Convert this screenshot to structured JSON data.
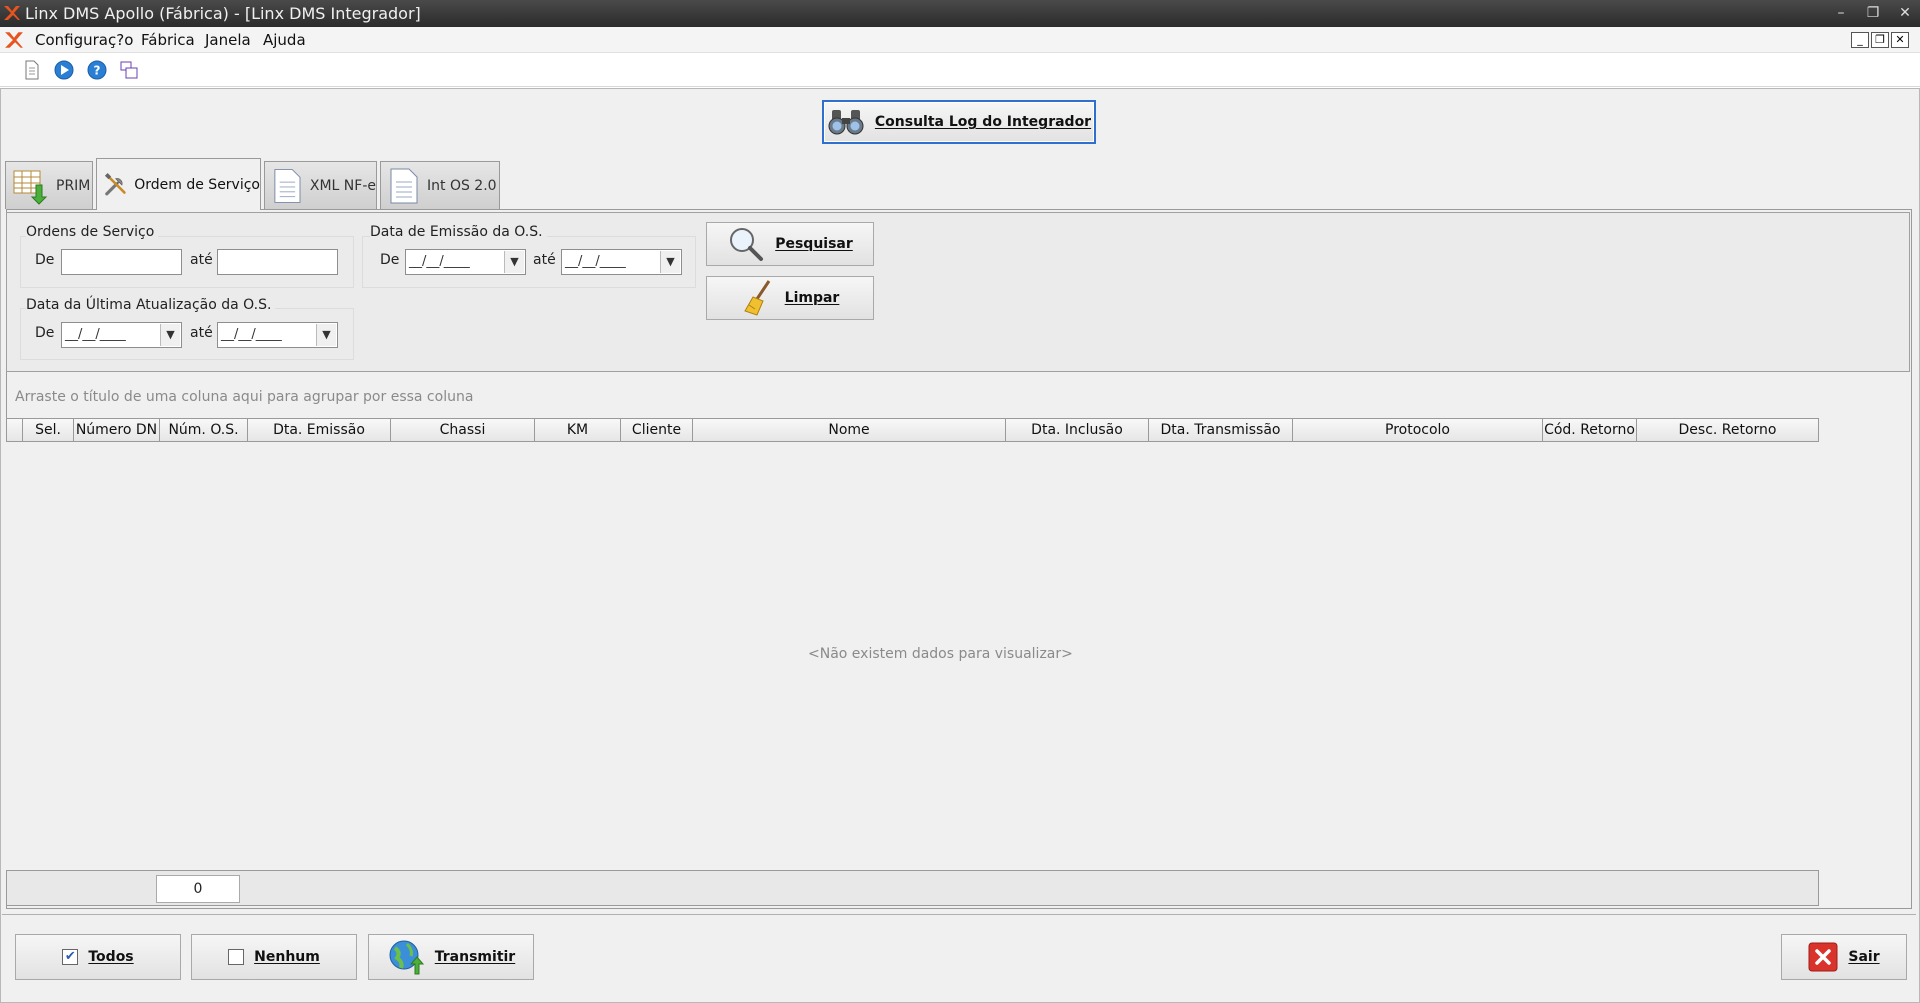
{
  "window": {
    "title": "Linx DMS Apollo (Fábrica) - [Linx DMS Integrador]"
  },
  "menu": [
    "Configuraç?o",
    "Fábrica",
    "Janela",
    "Ajuda"
  ],
  "log_button": "Consulta Log do Integrador",
  "tabs": [
    {
      "label": "PRIM",
      "icon": "table-arrow-icon"
    },
    {
      "label": "Ordem de Serviço",
      "icon": "tools-icon"
    },
    {
      "label": "XML NF-e",
      "icon": "document-icon"
    },
    {
      "label": "Int OS 2.0",
      "icon": "document-icon"
    }
  ],
  "filters": {
    "os_group": "Ordens de Serviço",
    "emissao_group": "Data de Emissão da O.S.",
    "atualizacao_group": "Data da Última Atualização da O.S.",
    "de": "De",
    "ate": "até",
    "date_placeholder": "__/__/____",
    "os_de_value": "",
    "os_ate_value": ""
  },
  "search_button": "Pesquisar",
  "clear_button": "Limpar",
  "grid": {
    "group_hint": "Arraste o título de uma coluna aqui para agrupar por essa coluna",
    "columns": [
      "",
      "Sel.",
      "Número DN",
      "Núm. O.S.",
      "Dta. Emissão",
      "Chassi",
      "KM",
      "Cliente",
      "Nome",
      "Dta. Inclusão",
      "Dta. Transmissão",
      "Protocolo",
      "Cód. Retorno",
      "Desc. Retorno"
    ],
    "empty_message": "<Não existem dados para visualizar>",
    "count": "0"
  },
  "bottom": {
    "todos": "Todos",
    "todos_checked": true,
    "nenhum": "Nenhum",
    "nenhum_checked": false,
    "transmitir": "Transmitir",
    "sair": "Sair"
  },
  "colors": {
    "accent": "#2f6fce",
    "close_red": "#d9342b",
    "title_bar": "#333333"
  }
}
